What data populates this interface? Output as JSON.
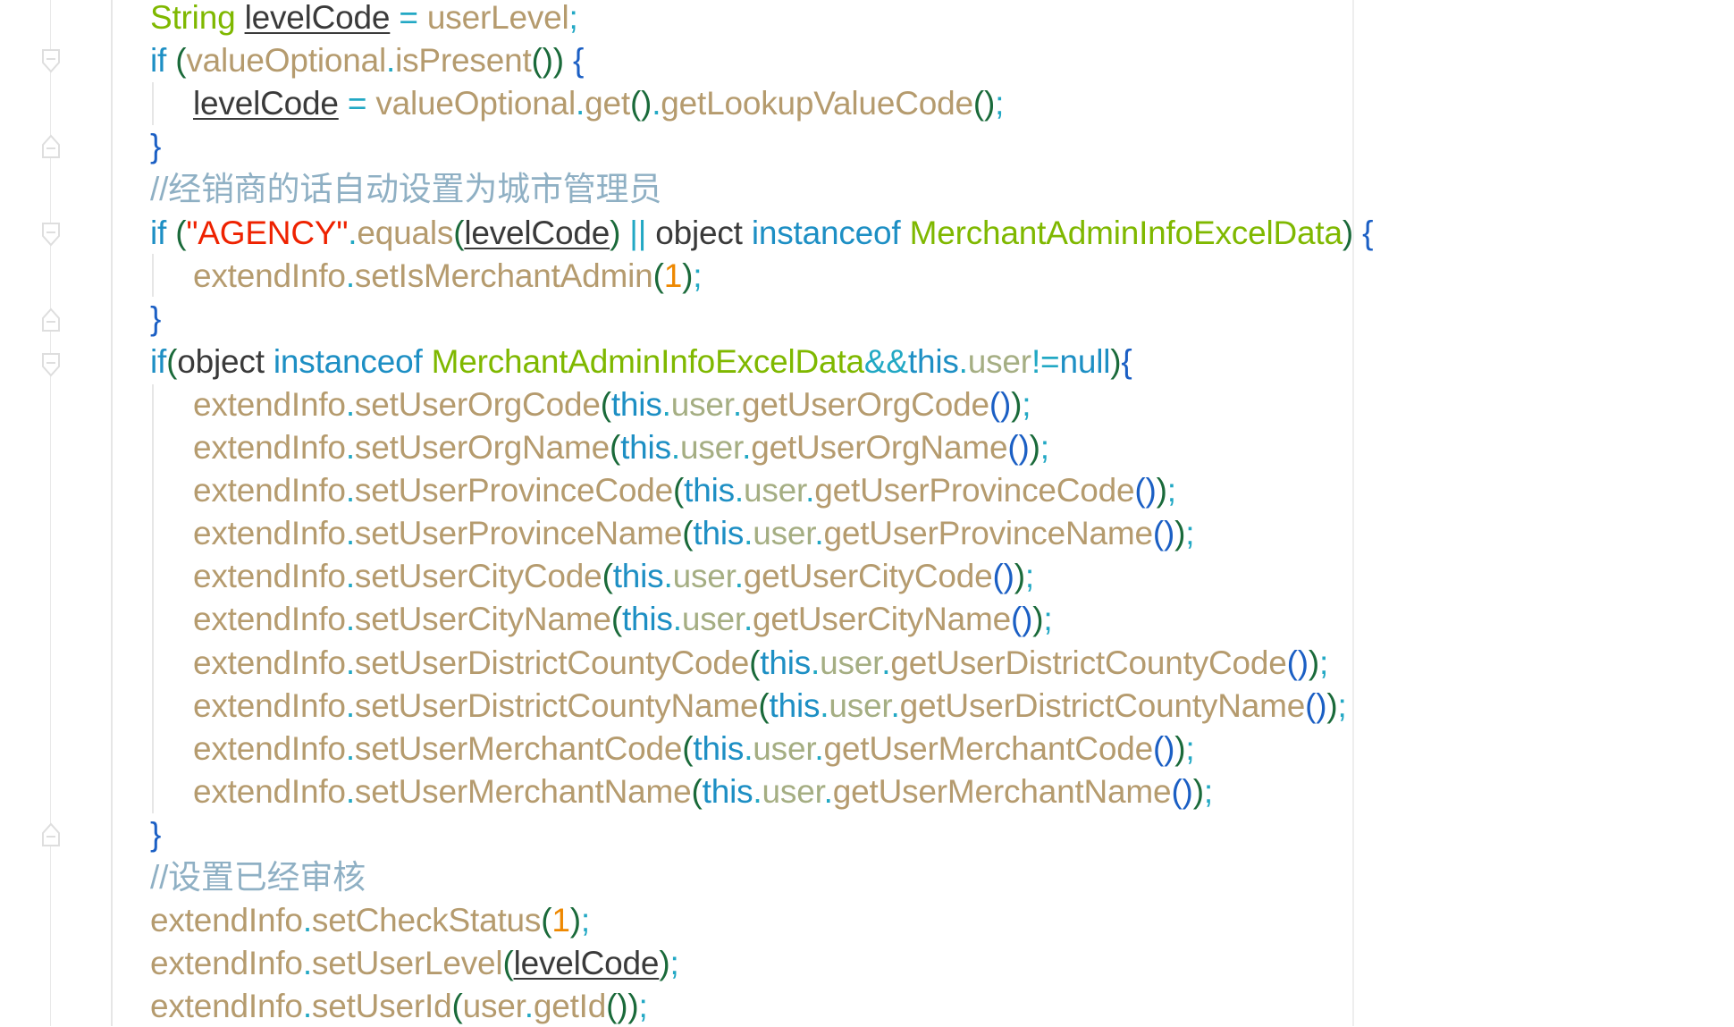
{
  "colors": {
    "background": "#ffffff",
    "keyword": "#1d8fc4",
    "type": "#7fb800",
    "method": "#b59b6e",
    "field": "#a5ae83",
    "variable": "#3a3a3a",
    "operator": "#22a8c4",
    "paren": "#1a6a3a",
    "brace": "#1b5fc4",
    "string": "#ee2200",
    "number": "#ee8800",
    "comment": "#8fb0c4",
    "gutter_line": "#e9e9e9",
    "indent_guide": "#e6e6e6"
  },
  "icons": {
    "fold_start": "fold-open-icon",
    "fold_end": "fold-close-icon"
  },
  "code_lines": [
    {
      "indent": 0,
      "tokens": [
        {
          "t": "String",
          "c": "type"
        },
        {
          "t": " ",
          "c": "variable"
        },
        {
          "t": "levelCode",
          "c": "variable",
          "u": true
        },
        {
          "t": " = ",
          "c": "operator"
        },
        {
          "t": "userLevel",
          "c": "method"
        },
        {
          "t": ";",
          "c": "operator"
        }
      ]
    },
    {
      "indent": 0,
      "tokens": [
        {
          "t": "if",
          "c": "keyword"
        },
        {
          "t": " ",
          "c": "variable"
        },
        {
          "t": "(",
          "c": "paren"
        },
        {
          "t": "valueOptional",
          "c": "method"
        },
        {
          "t": ".",
          "c": "operator"
        },
        {
          "t": "isPresent",
          "c": "method"
        },
        {
          "t": "())",
          "c": "paren"
        },
        {
          "t": " {",
          "c": "brace"
        }
      ]
    },
    {
      "indent": 1,
      "tokens": [
        {
          "t": "levelCode",
          "c": "variable",
          "u": true
        },
        {
          "t": " = ",
          "c": "operator"
        },
        {
          "t": "valueOptional",
          "c": "method"
        },
        {
          "t": ".",
          "c": "operator"
        },
        {
          "t": "get",
          "c": "method"
        },
        {
          "t": "()",
          "c": "paren"
        },
        {
          "t": ".",
          "c": "operator"
        },
        {
          "t": "getLookupValueCode",
          "c": "method"
        },
        {
          "t": "()",
          "c": "paren"
        },
        {
          "t": ";",
          "c": "operator"
        }
      ]
    },
    {
      "indent": 0,
      "tokens": [
        {
          "t": "}",
          "c": "brace"
        }
      ]
    },
    {
      "indent": 0,
      "tokens": [
        {
          "t": "//经销商的话自动设置为城市管理员",
          "c": "comment"
        }
      ]
    },
    {
      "indent": 0,
      "tokens": [
        {
          "t": "if",
          "c": "keyword"
        },
        {
          "t": " ",
          "c": "variable"
        },
        {
          "t": "(",
          "c": "paren"
        },
        {
          "t": "\"AGENCY\"",
          "c": "string"
        },
        {
          "t": ".",
          "c": "operator"
        },
        {
          "t": "equals",
          "c": "method"
        },
        {
          "t": "(",
          "c": "paren"
        },
        {
          "t": "levelCode",
          "c": "variable",
          "u": true
        },
        {
          "t": ")",
          "c": "paren"
        },
        {
          "t": " || ",
          "c": "operator"
        },
        {
          "t": "object",
          "c": "variable"
        },
        {
          "t": " ",
          "c": "variable"
        },
        {
          "t": "instanceof",
          "c": "keyword"
        },
        {
          "t": " ",
          "c": "variable"
        },
        {
          "t": "MerchantAdminInfoExcelData",
          "c": "type"
        },
        {
          "t": ")",
          "c": "paren"
        },
        {
          "t": " {",
          "c": "brace"
        }
      ]
    },
    {
      "indent": 1,
      "tokens": [
        {
          "t": "extendInfo",
          "c": "method"
        },
        {
          "t": ".",
          "c": "operator"
        },
        {
          "t": "setIsMerchantAdmin",
          "c": "method"
        },
        {
          "t": "(",
          "c": "paren"
        },
        {
          "t": "1",
          "c": "number"
        },
        {
          "t": ")",
          "c": "paren"
        },
        {
          "t": ";",
          "c": "operator"
        }
      ]
    },
    {
      "indent": 0,
      "tokens": [
        {
          "t": "}",
          "c": "brace"
        }
      ]
    },
    {
      "indent": 0,
      "tokens": [
        {
          "t": "if",
          "c": "keyword"
        },
        {
          "t": "(",
          "c": "paren"
        },
        {
          "t": "object",
          "c": "variable"
        },
        {
          "t": " ",
          "c": "variable"
        },
        {
          "t": "instanceof",
          "c": "keyword"
        },
        {
          "t": " ",
          "c": "variable"
        },
        {
          "t": "MerchantAdminInfoExcelData",
          "c": "type"
        },
        {
          "t": "&&",
          "c": "operator"
        },
        {
          "t": "this",
          "c": "keyword"
        },
        {
          "t": ".",
          "c": "operator"
        },
        {
          "t": "user",
          "c": "field"
        },
        {
          "t": "!=",
          "c": "operator"
        },
        {
          "t": "null",
          "c": "keyword"
        },
        {
          "t": ")",
          "c": "paren"
        },
        {
          "t": "{",
          "c": "brace"
        }
      ]
    },
    {
      "indent": 1,
      "tokens": [
        {
          "t": "extendInfo",
          "c": "method"
        },
        {
          "t": ".",
          "c": "operator"
        },
        {
          "t": "setUserOrgCode",
          "c": "method"
        },
        {
          "t": "(",
          "c": "paren"
        },
        {
          "t": "this",
          "c": "keyword"
        },
        {
          "t": ".",
          "c": "operator"
        },
        {
          "t": "user",
          "c": "field"
        },
        {
          "t": ".",
          "c": "operator"
        },
        {
          "t": "getUserOrgCode",
          "c": "method"
        },
        {
          "t": "()",
          "c": "brace"
        },
        {
          "t": ")",
          "c": "paren"
        },
        {
          "t": ";",
          "c": "operator"
        }
      ]
    },
    {
      "indent": 1,
      "tokens": [
        {
          "t": "extendInfo",
          "c": "method"
        },
        {
          "t": ".",
          "c": "operator"
        },
        {
          "t": "setUserOrgName",
          "c": "method"
        },
        {
          "t": "(",
          "c": "paren"
        },
        {
          "t": "this",
          "c": "keyword"
        },
        {
          "t": ".",
          "c": "operator"
        },
        {
          "t": "user",
          "c": "field"
        },
        {
          "t": ".",
          "c": "operator"
        },
        {
          "t": "getUserOrgName",
          "c": "method"
        },
        {
          "t": "()",
          "c": "brace"
        },
        {
          "t": ")",
          "c": "paren"
        },
        {
          "t": ";",
          "c": "operator"
        }
      ]
    },
    {
      "indent": 1,
      "tokens": [
        {
          "t": "extendInfo",
          "c": "method"
        },
        {
          "t": ".",
          "c": "operator"
        },
        {
          "t": "setUserProvinceCode",
          "c": "method"
        },
        {
          "t": "(",
          "c": "paren"
        },
        {
          "t": "this",
          "c": "keyword"
        },
        {
          "t": ".",
          "c": "operator"
        },
        {
          "t": "user",
          "c": "field"
        },
        {
          "t": ".",
          "c": "operator"
        },
        {
          "t": "getUserProvinceCode",
          "c": "method"
        },
        {
          "t": "()",
          "c": "brace"
        },
        {
          "t": ")",
          "c": "paren"
        },
        {
          "t": ";",
          "c": "operator"
        }
      ]
    },
    {
      "indent": 1,
      "tokens": [
        {
          "t": "extendInfo",
          "c": "method"
        },
        {
          "t": ".",
          "c": "operator"
        },
        {
          "t": "setUserProvinceName",
          "c": "method"
        },
        {
          "t": "(",
          "c": "paren"
        },
        {
          "t": "this",
          "c": "keyword"
        },
        {
          "t": ".",
          "c": "operator"
        },
        {
          "t": "user",
          "c": "field"
        },
        {
          "t": ".",
          "c": "operator"
        },
        {
          "t": "getUserProvinceName",
          "c": "method"
        },
        {
          "t": "()",
          "c": "brace"
        },
        {
          "t": ")",
          "c": "paren"
        },
        {
          "t": ";",
          "c": "operator"
        }
      ]
    },
    {
      "indent": 1,
      "tokens": [
        {
          "t": "extendInfo",
          "c": "method"
        },
        {
          "t": ".",
          "c": "operator"
        },
        {
          "t": "setUserCityCode",
          "c": "method"
        },
        {
          "t": "(",
          "c": "paren"
        },
        {
          "t": "this",
          "c": "keyword"
        },
        {
          "t": ".",
          "c": "operator"
        },
        {
          "t": "user",
          "c": "field"
        },
        {
          "t": ".",
          "c": "operator"
        },
        {
          "t": "getUserCityCode",
          "c": "method"
        },
        {
          "t": "()",
          "c": "brace"
        },
        {
          "t": ")",
          "c": "paren"
        },
        {
          "t": ";",
          "c": "operator"
        }
      ]
    },
    {
      "indent": 1,
      "tokens": [
        {
          "t": "extendInfo",
          "c": "method"
        },
        {
          "t": ".",
          "c": "operator"
        },
        {
          "t": "setUserCityName",
          "c": "method"
        },
        {
          "t": "(",
          "c": "paren"
        },
        {
          "t": "this",
          "c": "keyword"
        },
        {
          "t": ".",
          "c": "operator"
        },
        {
          "t": "user",
          "c": "field"
        },
        {
          "t": ".",
          "c": "operator"
        },
        {
          "t": "getUserCityName",
          "c": "method"
        },
        {
          "t": "()",
          "c": "brace"
        },
        {
          "t": ")",
          "c": "paren"
        },
        {
          "t": ";",
          "c": "operator"
        }
      ]
    },
    {
      "indent": 1,
      "tokens": [
        {
          "t": "extendInfo",
          "c": "method"
        },
        {
          "t": ".",
          "c": "operator"
        },
        {
          "t": "setUserDistrictCountyCode",
          "c": "method"
        },
        {
          "t": "(",
          "c": "paren"
        },
        {
          "t": "this",
          "c": "keyword"
        },
        {
          "t": ".",
          "c": "operator"
        },
        {
          "t": "user",
          "c": "field"
        },
        {
          "t": ".",
          "c": "operator"
        },
        {
          "t": "getUserDistrictCountyCode",
          "c": "method"
        },
        {
          "t": "()",
          "c": "brace"
        },
        {
          "t": ")",
          "c": "paren"
        },
        {
          "t": ";",
          "c": "operator"
        }
      ]
    },
    {
      "indent": 1,
      "tokens": [
        {
          "t": "extendInfo",
          "c": "method"
        },
        {
          "t": ".",
          "c": "operator"
        },
        {
          "t": "setUserDistrictCountyName",
          "c": "method"
        },
        {
          "t": "(",
          "c": "paren"
        },
        {
          "t": "this",
          "c": "keyword"
        },
        {
          "t": ".",
          "c": "operator"
        },
        {
          "t": "user",
          "c": "field"
        },
        {
          "t": ".",
          "c": "operator"
        },
        {
          "t": "getUserDistrictCountyName",
          "c": "method"
        },
        {
          "t": "()",
          "c": "brace"
        },
        {
          "t": ")",
          "c": "paren"
        },
        {
          "t": ";",
          "c": "operator"
        }
      ]
    },
    {
      "indent": 1,
      "tokens": [
        {
          "t": "extendInfo",
          "c": "method"
        },
        {
          "t": ".",
          "c": "operator"
        },
        {
          "t": "setUserMerchantCode",
          "c": "method"
        },
        {
          "t": "(",
          "c": "paren"
        },
        {
          "t": "this",
          "c": "keyword"
        },
        {
          "t": ".",
          "c": "operator"
        },
        {
          "t": "user",
          "c": "field"
        },
        {
          "t": ".",
          "c": "operator"
        },
        {
          "t": "getUserMerchantCode",
          "c": "method"
        },
        {
          "t": "()",
          "c": "brace"
        },
        {
          "t": ")",
          "c": "paren"
        },
        {
          "t": ";",
          "c": "operator"
        }
      ]
    },
    {
      "indent": 1,
      "tokens": [
        {
          "t": "extendInfo",
          "c": "method"
        },
        {
          "t": ".",
          "c": "operator"
        },
        {
          "t": "setUserMerchantName",
          "c": "method"
        },
        {
          "t": "(",
          "c": "paren"
        },
        {
          "t": "this",
          "c": "keyword"
        },
        {
          "t": ".",
          "c": "operator"
        },
        {
          "t": "user",
          "c": "field"
        },
        {
          "t": ".",
          "c": "operator"
        },
        {
          "t": "getUserMerchantName",
          "c": "method"
        },
        {
          "t": "()",
          "c": "brace"
        },
        {
          "t": ")",
          "c": "paren"
        },
        {
          "t": ";",
          "c": "operator"
        }
      ]
    },
    {
      "indent": 0,
      "tokens": [
        {
          "t": "}",
          "c": "brace"
        }
      ]
    },
    {
      "indent": 0,
      "tokens": [
        {
          "t": "//设置已经审核",
          "c": "comment"
        }
      ]
    },
    {
      "indent": 0,
      "tokens": [
        {
          "t": "extendInfo",
          "c": "method"
        },
        {
          "t": ".",
          "c": "operator"
        },
        {
          "t": "setCheckStatus",
          "c": "method"
        },
        {
          "t": "(",
          "c": "paren"
        },
        {
          "t": "1",
          "c": "number"
        },
        {
          "t": ")",
          "c": "paren"
        },
        {
          "t": ";",
          "c": "operator"
        }
      ]
    },
    {
      "indent": 0,
      "tokens": [
        {
          "t": "extendInfo",
          "c": "method"
        },
        {
          "t": ".",
          "c": "operator"
        },
        {
          "t": "setUserLevel",
          "c": "method"
        },
        {
          "t": "(",
          "c": "paren"
        },
        {
          "t": "levelCode",
          "c": "variable",
          "u": true
        },
        {
          "t": ")",
          "c": "paren"
        },
        {
          "t": ";",
          "c": "operator"
        }
      ]
    },
    {
      "indent": 0,
      "tokens": [
        {
          "t": "extendInfo",
          "c": "method"
        },
        {
          "t": ".",
          "c": "operator"
        },
        {
          "t": "setUserId",
          "c": "method"
        },
        {
          "t": "(",
          "c": "paren"
        },
        {
          "t": "user",
          "c": "method"
        },
        {
          "t": ".",
          "c": "operator"
        },
        {
          "t": "getId",
          "c": "method"
        },
        {
          "t": "()",
          "c": "paren"
        },
        {
          "t": ")",
          "c": "paren"
        },
        {
          "t": ";",
          "c": "operator"
        }
      ]
    }
  ]
}
